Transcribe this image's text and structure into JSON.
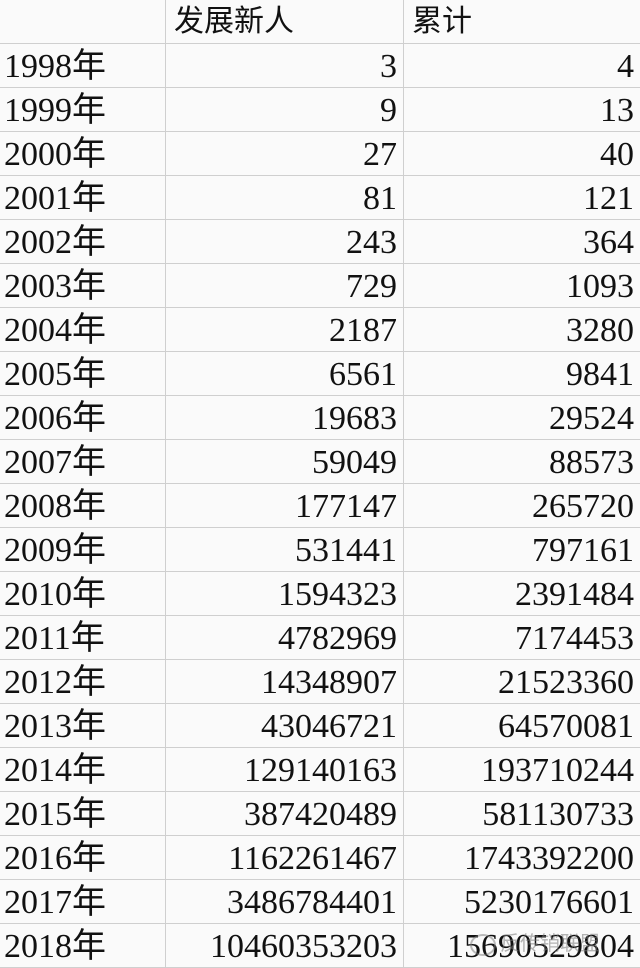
{
  "header": {
    "col0": "",
    "col1": "发展新人",
    "col2": "累计"
  },
  "rows": [
    {
      "year": "1998年",
      "new": "3",
      "total": "4"
    },
    {
      "year": "1999年",
      "new": "9",
      "total": "13"
    },
    {
      "year": "2000年",
      "new": "27",
      "total": "40"
    },
    {
      "year": "2001年",
      "new": "81",
      "total": "121"
    },
    {
      "year": "2002年",
      "new": "243",
      "total": "364"
    },
    {
      "year": "2003年",
      "new": "729",
      "total": "1093"
    },
    {
      "year": "2004年",
      "new": "2187",
      "total": "3280"
    },
    {
      "year": "2005年",
      "new": "6561",
      "total": "9841"
    },
    {
      "year": "2006年",
      "new": "19683",
      "total": "29524"
    },
    {
      "year": "2007年",
      "new": "59049",
      "total": "88573"
    },
    {
      "year": "2008年",
      "new": "177147",
      "total": "265720"
    },
    {
      "year": "2009年",
      "new": "531441",
      "total": "797161"
    },
    {
      "year": "2010年",
      "new": "1594323",
      "total": "2391484"
    },
    {
      "year": "2011年",
      "new": "4782969",
      "total": "7174453"
    },
    {
      "year": "2012年",
      "new": "14348907",
      "total": "21523360"
    },
    {
      "year": "2013年",
      "new": "43046721",
      "total": "64570081"
    },
    {
      "year": "2014年",
      "new": "129140163",
      "total": "193710244"
    },
    {
      "year": "2015年",
      "new": "387420489",
      "total": "581130733"
    },
    {
      "year": "2016年",
      "new": "1162261467",
      "total": "1743392200"
    },
    {
      "year": "2017年",
      "new": "3486784401",
      "total": "5230176601"
    },
    {
      "year": "2018年",
      "new": "10460353203",
      "total": "15690529804"
    }
  ],
  "watermark": {
    "text": "反传销联盟",
    "icon": "wechat-icon"
  }
}
